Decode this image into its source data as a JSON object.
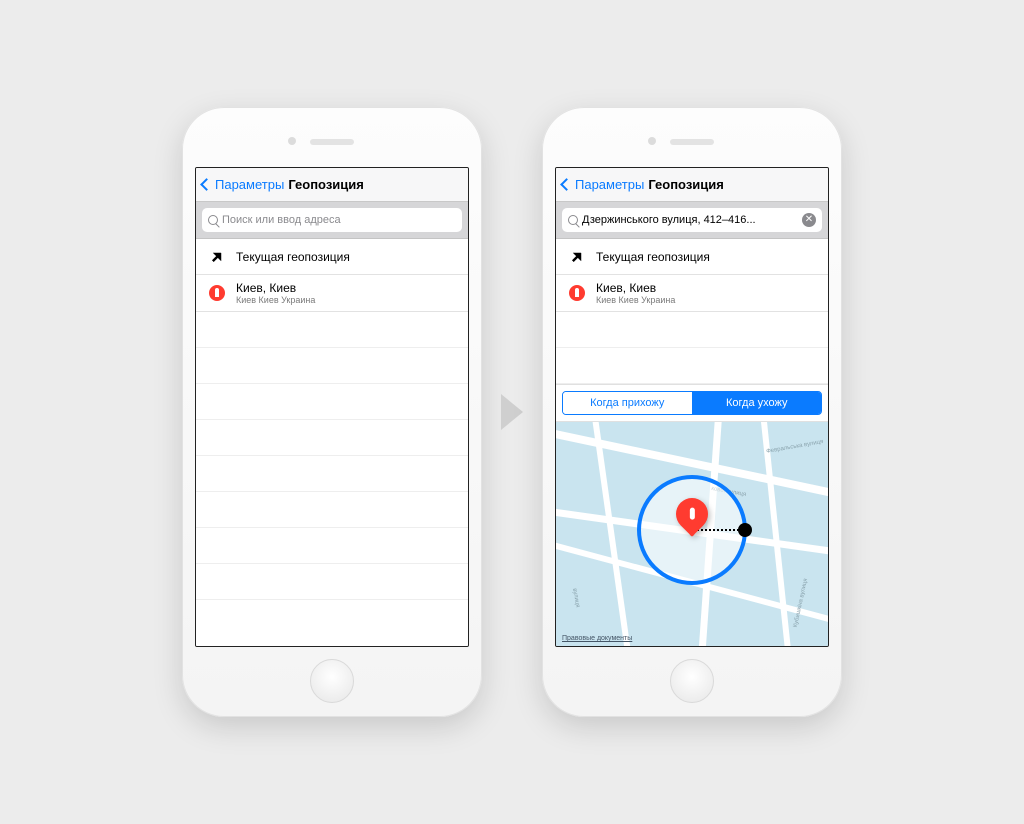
{
  "nav": {
    "back_label": "Параметры",
    "title": "Геопозиция"
  },
  "search": {
    "placeholder": "Поиск или ввод адреса",
    "filled_value": "Дзержинського вулиця, 412–416...",
    "clear_glyph": "✕"
  },
  "rows": {
    "current_location": "Текущая геопозиция",
    "pinned_title": "Киев, Киев",
    "pinned_sub": "Киев Киев Украина"
  },
  "segments": {
    "arrive": "Когда прихожу",
    "leave": "Когда ухожу"
  },
  "map": {
    "legal": "Правовые документы",
    "street1": "Февральська вулиця",
    "street2": "кової вулиця",
    "street3": "Кубишкіна вулиця",
    "street4": "вулиця"
  }
}
